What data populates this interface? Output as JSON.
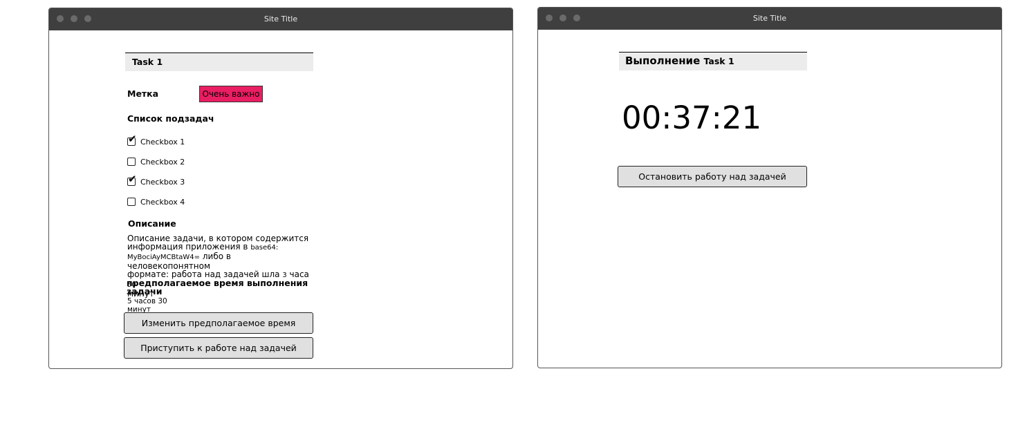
{
  "left_window": {
    "title": "Site Title",
    "task_title": "Task 1",
    "tag_label": "Метка",
    "tag_value": "Очень важно",
    "subtasks_title": "Список подзадач",
    "checkboxes": [
      {
        "label": "Checkbox 1",
        "checked": true
      },
      {
        "label": "Checkbox 2",
        "checked": false
      },
      {
        "label": "Checkbox 3",
        "checked": true
      },
      {
        "label": "Checkbox 4",
        "checked": false
      }
    ],
    "description_title": "Описание",
    "description_line1": "Описание задачи, в котором содержится",
    "description_line2_a": "информация приложения в ",
    "description_line2_b": "base64:",
    "description_line3_a": "MyBociAyMCBtaW4=",
    "description_line3_b": " либо в человекопонятном",
    "description_line4_a": "формате: работа над задачей шла ",
    "description_line4_b": "3",
    "description_line4_c": " часа ",
    "description_line4_d": "50",
    "description_line5": "минут",
    "estimate_title_1": "предполагаемое время выполнения",
    "estimate_title_2": "задачи",
    "estimate_value_1": "5 часов 30",
    "estimate_value_2": "минут",
    "change_time_button": "Изменить предполагаемое время",
    "start_work_button": "Приступить к работе над задачей"
  },
  "right_window": {
    "title": "Site Title",
    "heading_word": "Выполнение",
    "heading_task": "Task 1",
    "timer": "00:37:21",
    "stop_button": "Остановить работу над задачей"
  },
  "colors": {
    "titlebar": "#3f3f3f",
    "tag_background": "#e91e63",
    "button_background": "#e0e0e0",
    "header_background": "#ececec"
  }
}
